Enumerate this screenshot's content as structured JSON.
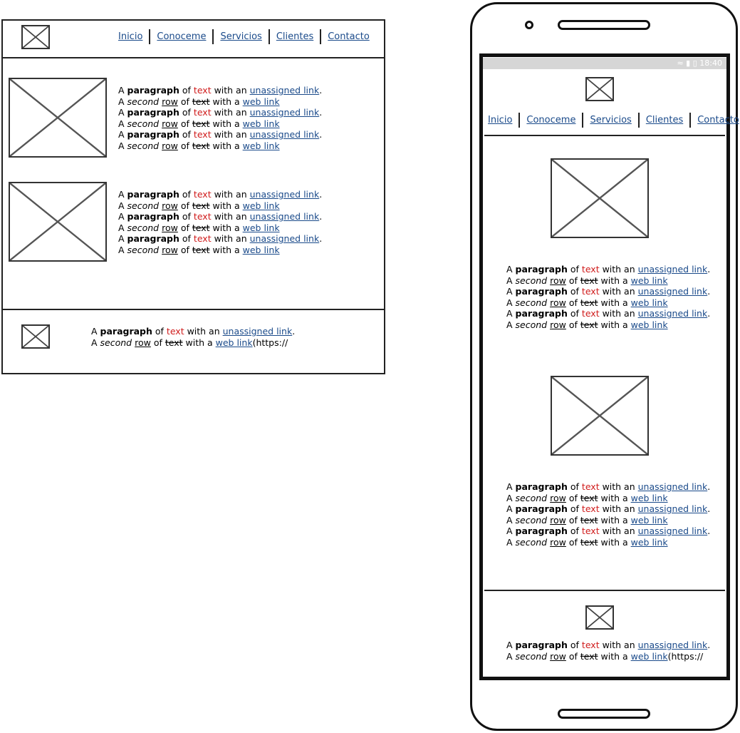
{
  "nav": [
    "Inicio",
    "Conoceme",
    "Servicios",
    "Clientes",
    "Contacto"
  ],
  "paragraph": {
    "line1": {
      "a": "A ",
      "b": "paragraph",
      "c": " of ",
      "d": "text",
      "e": " with an ",
      "f": "unassigned link",
      "g": "."
    },
    "line2": {
      "a": "A ",
      "b": "second",
      "c": " ",
      "d": "row",
      "e": " of ",
      "f": "text",
      "g": " with a ",
      "h": "web link"
    }
  },
  "footer_tail": "(https://",
  "phone": {
    "status_time": "18:40",
    "status_icons": "wifi signal battery"
  },
  "colors": {
    "link": "#1a4a8a",
    "highlight": "#d01c1c",
    "status_bar": "#d6d6d6"
  }
}
